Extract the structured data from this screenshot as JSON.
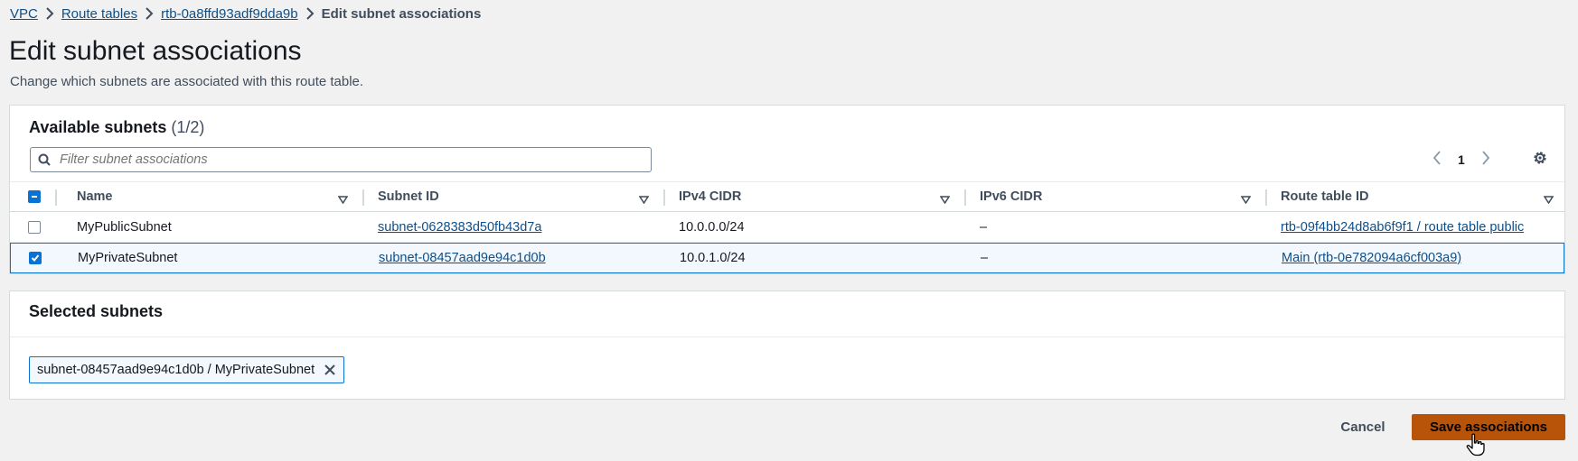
{
  "breadcrumb": {
    "items": [
      "VPC",
      "Route tables",
      "rtb-0a8ffd93adf9dda9b"
    ],
    "current": "Edit subnet associations"
  },
  "page": {
    "title": "Edit subnet associations",
    "description": "Change which subnets are associated with this route table."
  },
  "available": {
    "title": "Available subnets",
    "count": "(1/2)",
    "filter_placeholder": "Filter subnet associations",
    "page_number": "1",
    "columns": [
      "Name",
      "Subnet ID",
      "IPv4 CIDR",
      "IPv6 CIDR",
      "Route table ID"
    ],
    "rows": [
      {
        "checked": false,
        "name": "MyPublicSubnet",
        "subnet_id": "subnet-0628383d50fb43d7a",
        "ipv4": "10.0.0.0/24",
        "ipv6": "–",
        "route_table": "rtb-09f4bb24d8ab6f9f1 / route table public"
      },
      {
        "checked": true,
        "name": "MyPrivateSubnet",
        "subnet_id": "subnet-08457aad9e94c1d0b",
        "ipv4": "10.0.1.0/24",
        "ipv6": "–",
        "route_table": "Main (rtb-0e782094a6cf003a9)"
      }
    ]
  },
  "selected": {
    "title": "Selected subnets",
    "tokens": [
      "subnet-08457aad9e94c1d0b / MyPrivateSubnet"
    ]
  },
  "footer": {
    "cancel_label": "Cancel",
    "save_label": "Save associations"
  },
  "colors": {
    "primary_button": "#b8540a",
    "link": "#0f4f87",
    "selection": "#0972d3"
  }
}
